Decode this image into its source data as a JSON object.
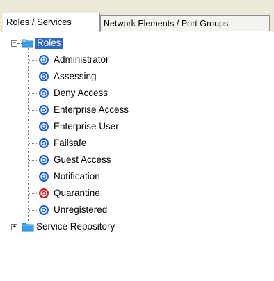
{
  "tabs": [
    {
      "label": "Roles / Services",
      "active": true
    },
    {
      "label": "Network Elements / Port Groups",
      "active": false
    }
  ],
  "tree": {
    "roles_folder": {
      "label": "Roles",
      "expanded": true,
      "selected": true,
      "expander_symbol": "−",
      "icon": "folder-open-icon"
    },
    "roles": [
      {
        "label": "Administrator",
        "icon": "role-icon",
        "status_color": "#1a5fd6"
      },
      {
        "label": "Assessing",
        "icon": "role-icon",
        "status_color": "#1a5fd6"
      },
      {
        "label": "Deny Access",
        "icon": "role-icon",
        "status_color": "#1a5fd6"
      },
      {
        "label": "Enterprise Access",
        "icon": "role-icon",
        "status_color": "#1a5fd6"
      },
      {
        "label": "Enterprise User",
        "icon": "role-icon",
        "status_color": "#1a5fd6"
      },
      {
        "label": "Failsafe",
        "icon": "role-icon",
        "status_color": "#1a5fd6"
      },
      {
        "label": "Guest Access",
        "icon": "role-icon",
        "status_color": "#1a5fd6"
      },
      {
        "label": "Notification",
        "icon": "role-icon",
        "status_color": "#1a5fd6"
      },
      {
        "label": "Quarantine",
        "icon": "quarantine-role-icon",
        "status_color": "#c81e1e"
      },
      {
        "label": "Unregistered",
        "icon": "role-icon",
        "status_color": "#1a5fd6"
      }
    ],
    "service_folder": {
      "label": "Service Repository",
      "expanded": false,
      "expander_symbol": "+",
      "icon": "folder-closed-icon"
    }
  },
  "colors": {
    "selection": "#316ac5",
    "folder": "#3da0e6",
    "role_blue": "#1a5fd6",
    "role_red": "#c81e1e"
  }
}
